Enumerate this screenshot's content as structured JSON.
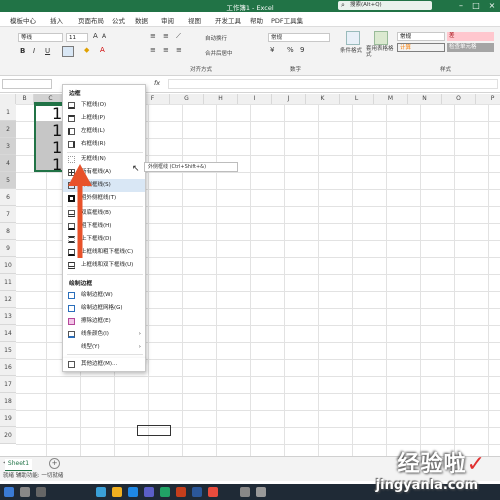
{
  "window": {
    "title": "工作簿1 - Excel",
    "search_placeholder": "搜索(Alt+Q)",
    "account_initial": ""
  },
  "tabs": [
    "模板中心",
    "插入",
    "页面布局",
    "公式",
    "数据",
    "审阅",
    "视图",
    "开发工具",
    "帮助",
    "PDF工具集"
  ],
  "ribbon": {
    "font_name": "等线",
    "font_size": "11",
    "wrap_text": "自动换行",
    "merge_center": "合并后居中",
    "number_format": "常规",
    "group_align": "对齐方式",
    "group_number": "数字",
    "group_styles": "样式",
    "cond_format": "条件格式",
    "table_format": "套用表格格式",
    "styles": [
      {
        "label": "常规",
        "bg": "#ffffff",
        "fg": "#000000"
      },
      {
        "label": "差",
        "bg": "#ffc7ce",
        "fg": "#9c0006"
      },
      {
        "label": "计算",
        "bg": "#f2f2f2",
        "fg": "#fa7d00"
      },
      {
        "label": "检查单元格",
        "bg": "#a5a5a5",
        "fg": "#ffffff"
      }
    ]
  },
  "formula_bar": {
    "name_box": "",
    "fx": "fx"
  },
  "columns": [
    "B",
    "C",
    "D",
    "E",
    "F",
    "G",
    "H",
    "I",
    "J",
    "K",
    "L",
    "M",
    "N",
    "O",
    "P"
  ],
  "rows": [
    "1",
    "2",
    "3",
    "4",
    "5",
    "6",
    "7",
    "8",
    "9",
    "10",
    "11",
    "12",
    "13",
    "14",
    "15",
    "16",
    "17",
    "18",
    "19",
    "20"
  ],
  "cells": [
    "1",
    "1",
    "1",
    "1"
  ],
  "menu": {
    "header_borders": "边框",
    "items": [
      "下框线(O)",
      "上框线(P)",
      "左框线(L)",
      "右框线(R)",
      "无框线(N)",
      "所有框线(A)",
      "外侧框线(S)",
      "粗外侧框线(T)",
      "双底框线(B)",
      "粗下框线(H)",
      "上下框线(D)",
      "上框线和粗下框线(C)",
      "上框线和双下框线(U)"
    ],
    "header_draw": "绘制边框",
    "draw_items": [
      "绘制边框(W)",
      "绘制边框网格(G)",
      "擦除边框(E)",
      "线条颜色(I)",
      "线型(Y)",
      "其他边框(M)..."
    ],
    "tooltip": "外侧框线 (Ctrl+Shift+&)"
  },
  "sheet_tab": "Sheet1",
  "status": "就绪   辅助功能: 一切就绪",
  "watermark": {
    "line1": "经验啦",
    "check": "✓",
    "line2": "jingyanla.com"
  },
  "colors": {
    "excel_green": "#217346",
    "arrow_red": "#e8522a",
    "selection": "#c6c6c6"
  }
}
